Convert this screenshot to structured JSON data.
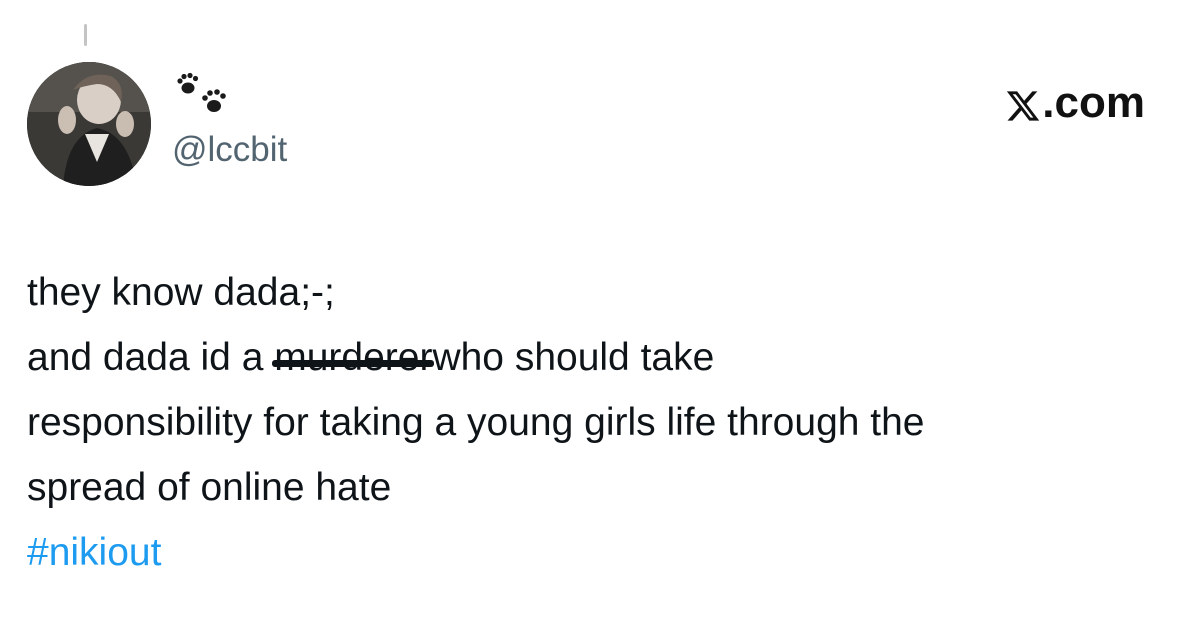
{
  "tweet": {
    "avatar_icon": "profile-photo",
    "display_name_icon": "paw-prints-icon",
    "handle": "@lccbit",
    "lines": [
      "they know dada;-;",
      "and dada id a ",
      "murderer",
      "who should take",
      "responsibility for taking a young girls life through the",
      "spread of online hate"
    ],
    "hashtag": "#nikiout"
  },
  "watermark": {
    "icon": "x-logo-icon",
    "text": ".com"
  },
  "colors": {
    "text": "#0f1419",
    "handle": "#536471",
    "hashtag": "#1d9bf0"
  }
}
